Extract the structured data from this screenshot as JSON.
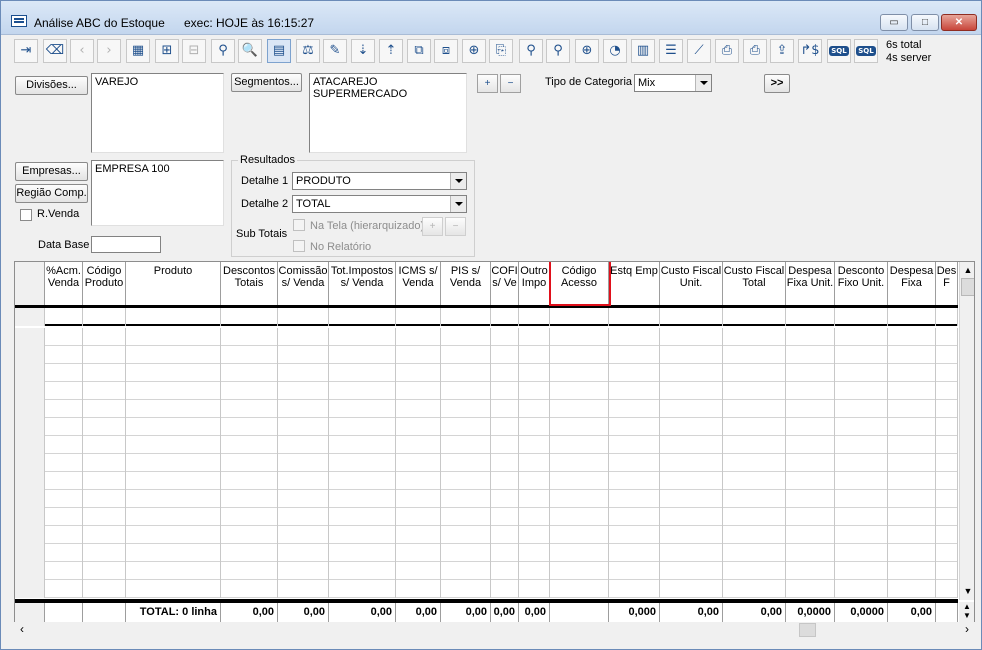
{
  "window": {
    "title": "Análise ABC do Estoque",
    "exec": "exec: HOJE às 16:15:27",
    "controls": {
      "minimize": "▭",
      "maximize": "□",
      "close": "✕"
    }
  },
  "toolbar": {
    "buttons": [
      {
        "name": "exit",
        "glyph": "⇥",
        "enabled": true
      },
      {
        "name": "eraser",
        "glyph": "⌫",
        "enabled": true
      },
      {
        "name": "back",
        "glyph": "‹",
        "enabled": false
      },
      {
        "name": "forward",
        "glyph": "›",
        "enabled": false
      },
      {
        "name": "grid",
        "glyph": "▦",
        "enabled": true
      },
      {
        "name": "add-grid",
        "glyph": "⊞",
        "enabled": true
      },
      {
        "name": "remove-grid",
        "glyph": "⊟",
        "enabled": false
      },
      {
        "name": "filter",
        "glyph": "⚲",
        "enabled": true
      },
      {
        "name": "search",
        "glyph": "🔍",
        "enabled": true
      },
      {
        "name": "report",
        "glyph": "▤",
        "enabled": true,
        "selected": true
      },
      {
        "name": "balance",
        "glyph": "⚖",
        "enabled": true
      },
      {
        "name": "edit-sort",
        "glyph": "✎",
        "enabled": true
      },
      {
        "name": "sort-desc",
        "glyph": "⇣",
        "enabled": true
      },
      {
        "name": "sort-asc",
        "glyph": "⇡",
        "enabled": true
      },
      {
        "name": "group",
        "glyph": "⧉",
        "enabled": true
      },
      {
        "name": "ungroup",
        "glyph": "⧈",
        "enabled": true
      },
      {
        "name": "grid-plus",
        "glyph": "⊕",
        "enabled": true
      },
      {
        "name": "copy",
        "glyph": "⎘",
        "enabled": true
      },
      {
        "name": "filter-edit",
        "glyph": "⚲",
        "enabled": true
      },
      {
        "name": "filter-clear",
        "glyph": "⚲",
        "enabled": true
      },
      {
        "name": "zoom",
        "glyph": "⊕",
        "enabled": true
      },
      {
        "name": "pie-chart",
        "glyph": "◔",
        "enabled": true
      },
      {
        "name": "bar-chart",
        "glyph": "▥",
        "enabled": true
      },
      {
        "name": "hbar-chart",
        "glyph": "☰",
        "enabled": true
      },
      {
        "name": "line-chart",
        "glyph": "⟋",
        "enabled": true
      },
      {
        "name": "print",
        "glyph": "⎙",
        "enabled": true
      },
      {
        "name": "print-settings",
        "glyph": "⎙",
        "enabled": true
      },
      {
        "name": "export",
        "glyph": "⇪",
        "enabled": true
      },
      {
        "name": "currency",
        "glyph": "↱$",
        "enabled": true
      },
      {
        "name": "sql-1",
        "glyph": "SQL",
        "enabled": true
      },
      {
        "name": "sql-2",
        "glyph": "SQL",
        "enabled": true
      }
    ],
    "timing_total": "6s  total",
    "timing_server": "4s  server"
  },
  "filters": {
    "divisoes_button": "Divisões...",
    "divisoes_values": [
      "VAREJO"
    ],
    "segmentos_button": "Segmentos...",
    "segmentos_values": [
      "ATACAREJO",
      "SUPERMERCADO"
    ],
    "add_button": "+",
    "remove_button": "−",
    "tipo_categoria_label": "Tipo de Categoria",
    "tipo_categoria_value": "Mix",
    "expand_button": ">>",
    "empresas_button": "Empresas...",
    "empresas_values": [
      "EMPRESA 100"
    ],
    "regiao_button": "Região Comp.",
    "rvenda_label": "R.Venda",
    "data_base_label": "Data Base",
    "data_base_value": ""
  },
  "resultados": {
    "title": "Resultados",
    "detalhe1_label": "Detalhe 1",
    "detalhe1_value": "PRODUTO",
    "detalhe2_label": "Detalhe 2",
    "detalhe2_value": "TOTAL",
    "subtotais_label": "Sub Totais",
    "na_tela_label": "Na Tela (hierarquizado)",
    "no_relatorio_label": "No Relatório"
  },
  "grid": {
    "columns": [
      {
        "label": "",
        "w": 30
      },
      {
        "label": "%Acm. Venda",
        "w": 38
      },
      {
        "label": "Código Produto",
        "w": 43
      },
      {
        "label": "Produto",
        "w": 95
      },
      {
        "label": "Descontos Totais",
        "w": 57
      },
      {
        "label": "Comissão s/ Venda",
        "w": 51
      },
      {
        "label": "Tot.Impostos s/ Venda",
        "w": 67
      },
      {
        "label": "ICMS s/ Venda",
        "w": 45
      },
      {
        "label": "PIS s/ Venda",
        "w": 50
      },
      {
        "label": "COFI s/ Ve",
        "w": 28
      },
      {
        "label": "Outro Impo",
        "w": 31
      },
      {
        "label": "Código Acesso",
        "w": 59
      },
      {
        "label": "Estq Emp",
        "w": 51
      },
      {
        "label": "Custo Fiscal Unit.",
        "w": 63
      },
      {
        "label": "Custo Fiscal Total",
        "w": 63
      },
      {
        "label": "Despesa Fixa Unit.",
        "w": 49
      },
      {
        "label": "Desconto Fixo Unit.",
        "w": 53
      },
      {
        "label": "Despesa Fixa",
        "w": 48
      },
      {
        "label": "Des F",
        "w": 22
      }
    ],
    "empty_rows": 16,
    "footer": [
      "",
      "",
      "",
      "TOTAL: 0 linha",
      "0,00",
      "0,00",
      "0,00",
      "0,00",
      "0,00",
      "0,00",
      "0,00",
      "",
      "0,000",
      "0,00",
      "0,00",
      "0,0000",
      "0,0000",
      "0,00",
      ""
    ],
    "highlighted_column": "Código Acesso"
  }
}
